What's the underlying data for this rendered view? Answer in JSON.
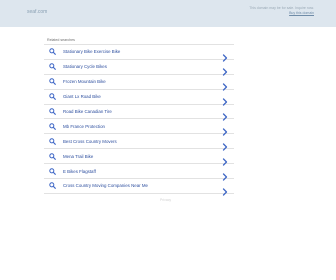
{
  "header": {
    "domain": "seaf.com",
    "notice_text": "This domain may be for sale. Inquire now.",
    "notice_link": "Buy this domain"
  },
  "related": {
    "heading": "Related searches",
    "items": [
      {
        "label": "Stationary Bike Exercise Bike"
      },
      {
        "label": "Stationary Cycle Bikes"
      },
      {
        "label": "Frozen Mountain Bike"
      },
      {
        "label": "Giant Lx Road Bike"
      },
      {
        "label": "Road Bike Canadian Tire"
      },
      {
        "label": "Mb France Protection"
      },
      {
        "label": "Best Cross Country Movers"
      },
      {
        "label": "Mena Trail Bike"
      },
      {
        "label": "E Bikes Flagstaff"
      },
      {
        "label": "Cross Country Moving Companies Near Me"
      }
    ]
  },
  "footer": {
    "text": "Privacy"
  },
  "colors": {
    "topbar": "#dde6ee",
    "link": "#2b4d9e",
    "icon": "#3f67c6"
  }
}
